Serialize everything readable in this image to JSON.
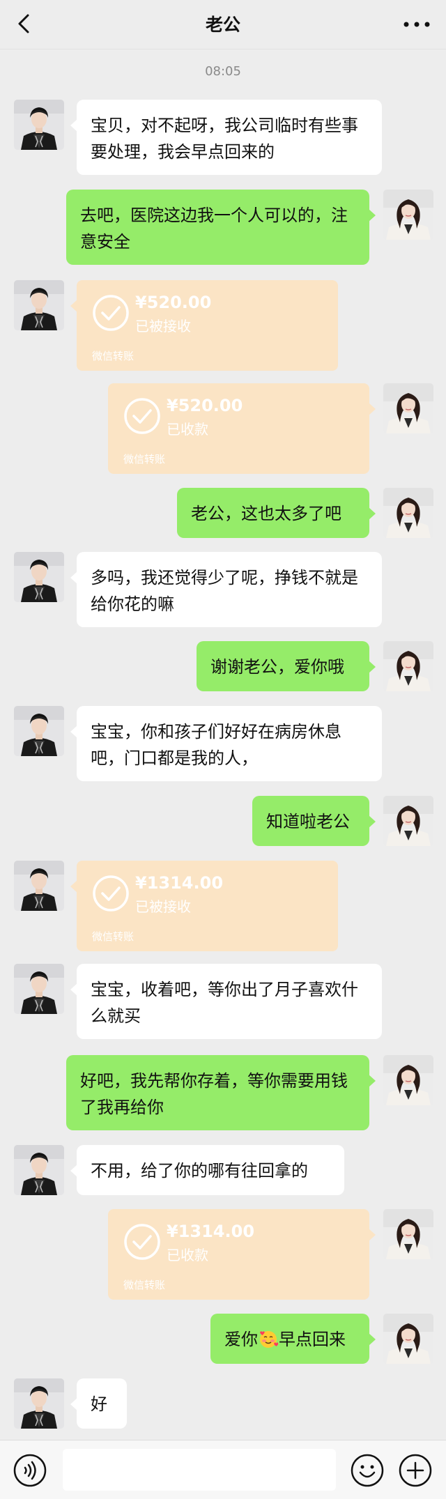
{
  "header": {
    "title": "老公",
    "back_icon": "chevron-left-icon",
    "more_icon": "more-icon"
  },
  "timestamp": "08:05",
  "colors": {
    "background": "#ededed",
    "incoming_bubble": "#ffffff",
    "outgoing_bubble": "#95ec69",
    "transfer_card": "#fbe4c5"
  },
  "messages": [
    {
      "from": "husband",
      "type": "text",
      "text": "宝贝，对不起呀，我公司临时有些事要处理，我会早点回来的"
    },
    {
      "from": "me",
      "type": "text",
      "text": "去吧，医院这边我一个人可以的，注意安全"
    },
    {
      "from": "husband",
      "type": "transfer",
      "amount": "¥520.00",
      "status": "已被接收",
      "footer": "微信转账"
    },
    {
      "from": "me",
      "type": "transfer",
      "amount": "¥520.00",
      "status": "已收款",
      "footer": "微信转账"
    },
    {
      "from": "me",
      "type": "text",
      "text": "老公，这也太多了吧"
    },
    {
      "from": "husband",
      "type": "text",
      "text": "多吗，我还觉得少了呢，挣钱不就是给你花的嘛"
    },
    {
      "from": "me",
      "type": "text",
      "text": "谢谢老公，爱你哦"
    },
    {
      "from": "husband",
      "type": "text",
      "text": "宝宝，你和孩子们好好在病房休息吧，门口都是我的人，"
    },
    {
      "from": "me",
      "type": "text",
      "text": "知道啦老公"
    },
    {
      "from": "husband",
      "type": "transfer",
      "amount": "¥1314.00",
      "status": "已被接收",
      "footer": "微信转账"
    },
    {
      "from": "husband",
      "type": "text",
      "text": "宝宝，收着吧，等你出了月子喜欢什么就买"
    },
    {
      "from": "me",
      "type": "text",
      "text": "好吧，我先帮你存着，等你需要用钱了我再给你"
    },
    {
      "from": "husband",
      "type": "text",
      "text": "不用，给了你的哪有往回拿的"
    },
    {
      "from": "me",
      "type": "transfer",
      "amount": "¥1314.00",
      "status": "已收款",
      "footer": "微信转账"
    },
    {
      "from": "me",
      "type": "text",
      "text_before": "爱你",
      "emoji": "smiling-face-with-hearts-icon",
      "text_after": "早点回来"
    },
    {
      "from": "husband",
      "type": "text",
      "text": "好"
    }
  ],
  "input_bar": {
    "voice_icon": "voice-icon",
    "input_value": "",
    "emoji_icon": "emoji-face-icon",
    "plus_icon": "plus-icon"
  }
}
